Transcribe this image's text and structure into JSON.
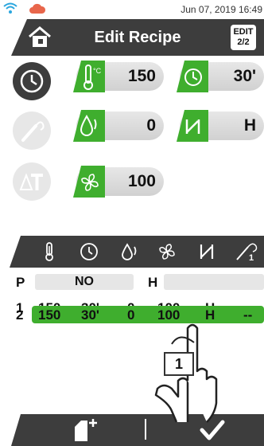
{
  "status_bar": {
    "datetime": "Jun 07, 2019 16:49"
  },
  "header": {
    "title": "Edit Recipe",
    "edit_label_top": "EDIT",
    "edit_label_bottom": "2/2"
  },
  "parameters": {
    "temperature": "150",
    "time": "30'",
    "humidity": "0",
    "fan": "100",
    "hold_mode": "H"
  },
  "table": {
    "program_label": "P",
    "program_value": "NO",
    "hold_label": "H",
    "rows": [
      {
        "index": "1",
        "temp": "150",
        "time": "30'",
        "humidity": "0",
        "fan": "100",
        "hold": "H",
        "probe": "--"
      },
      {
        "index": "2",
        "temp": "150",
        "time": "30'",
        "humidity": "0",
        "fan": "100",
        "hold": "H",
        "probe": "--"
      }
    ]
  },
  "tutorial": {
    "step": "1"
  },
  "colors": {
    "green": "#3fae2e",
    "dark": "#3d3d3d",
    "light": "#e7e7e7"
  }
}
